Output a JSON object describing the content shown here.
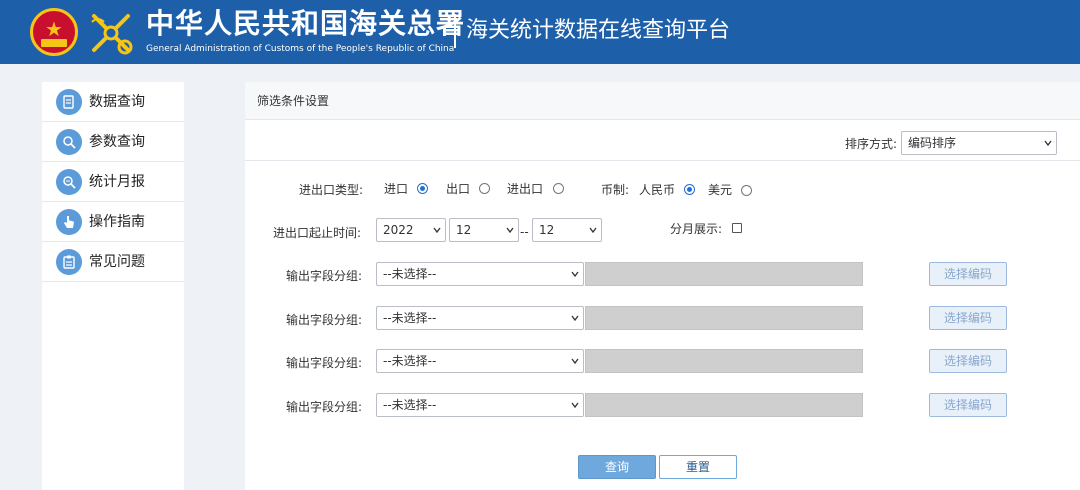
{
  "header": {
    "title_cn": "中华人民共和国海关总署",
    "title_en": "General Administration of Customs of the People's Republic of China",
    "subtitle": "海关统计数据在线查询平台"
  },
  "sidebar": {
    "items": [
      {
        "label": "数据查询",
        "icon": "data-query-icon"
      },
      {
        "label": "参数查询",
        "icon": "param-search-icon"
      },
      {
        "label": "统计月报",
        "icon": "monthly-report-icon"
      },
      {
        "label": "操作指南",
        "icon": "guide-hand-icon"
      },
      {
        "label": "常见问题",
        "icon": "faq-clipboard-icon"
      }
    ]
  },
  "panel": {
    "title": "筛选条件设置",
    "sort": {
      "label": "排序方式:",
      "value": "编码排序"
    },
    "trade_type": {
      "label": "进出口类型:",
      "options": [
        {
          "label": "进口",
          "selected": true
        },
        {
          "label": "出口",
          "selected": false
        },
        {
          "label": "进出口",
          "selected": false
        }
      ]
    },
    "currency": {
      "label": "币制:",
      "options": [
        {
          "label": "人民币",
          "selected": true
        },
        {
          "label": "美元",
          "selected": false
        }
      ]
    },
    "time": {
      "label": "进出口起止时间:",
      "year": "2022",
      "start_month": "12",
      "separator": "--",
      "end_month": "12"
    },
    "monthly": {
      "label": "分月展示:",
      "checked": false
    },
    "output_groups": [
      {
        "label": "输出字段分组:",
        "value": "--未选择--",
        "button": "选择编码"
      },
      {
        "label": "输出字段分组:",
        "value": "--未选择--",
        "button": "选择编码"
      },
      {
        "label": "输出字段分组:",
        "value": "--未选择--",
        "button": "选择编码"
      },
      {
        "label": "输出字段分组:",
        "value": "--未选择--",
        "button": "选择编码"
      }
    ],
    "buttons": {
      "query": "查询",
      "reset": "重置"
    }
  },
  "colors": {
    "header_bg": "#1d5fa8",
    "accent": "#6fa8dc",
    "sidebar_icon_bg": "#5b9bd9"
  }
}
